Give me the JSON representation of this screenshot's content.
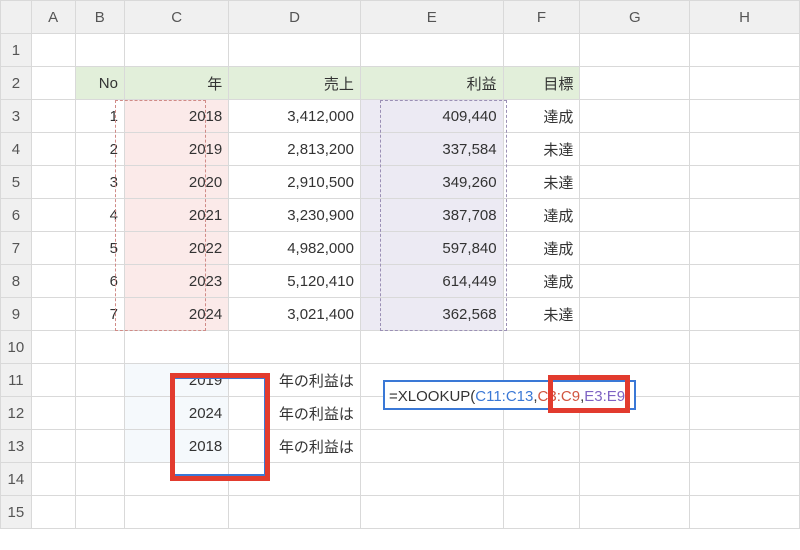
{
  "columns": [
    "A",
    "B",
    "C",
    "D",
    "E",
    "F",
    "G",
    "H"
  ],
  "rowCount": 15,
  "headers": {
    "no": "No",
    "year": "年",
    "sales": "売上",
    "profit": "利益",
    "target": "目標"
  },
  "table": [
    {
      "no": "1",
      "year": "2018",
      "sales": "3,412,000",
      "profit": "409,440",
      "target": "達成"
    },
    {
      "no": "2",
      "year": "2019",
      "sales": "2,813,200",
      "profit": "337,584",
      "target": "未達"
    },
    {
      "no": "3",
      "year": "2020",
      "sales": "2,910,500",
      "profit": "349,260",
      "target": "未達"
    },
    {
      "no": "4",
      "year": "2021",
      "sales": "3,230,900",
      "profit": "387,708",
      "target": "達成"
    },
    {
      "no": "5",
      "year": "2022",
      "sales": "4,982,000",
      "profit": "597,840",
      "target": "達成"
    },
    {
      "no": "6",
      "year": "2023",
      "sales": "5,120,410",
      "profit": "614,449",
      "target": "達成"
    },
    {
      "no": "7",
      "year": "2024",
      "sales": "3,021,400",
      "profit": "362,568",
      "target": "未達"
    }
  ],
  "lookup": {
    "rows": [
      {
        "year": "2019",
        "label": "年の利益は"
      },
      {
        "year": "2024",
        "label": "年の利益は"
      },
      {
        "year": "2018",
        "label": "年の利益は"
      }
    ]
  },
  "formula": {
    "prefix": "=XLOOKUP(",
    "arg1": "C11:C13",
    "arg2": "C3:C9",
    "arg3": "E3:E9",
    "suffix": ")"
  }
}
